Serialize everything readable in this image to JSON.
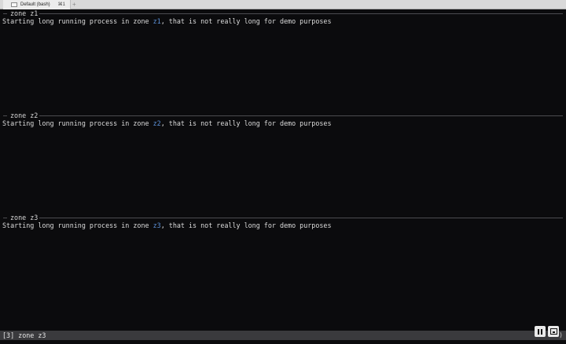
{
  "tabbar": {
    "tab_title": "Default (bash)",
    "tab_shortcut": "⌘1",
    "add_tab": "+"
  },
  "zones": [
    {
      "title": "zone z1",
      "output_prefix": "Starting long running process in zone ",
      "zone_id": "z1",
      "output_suffix": ", that is not really long for demo purposes"
    },
    {
      "title": "zone z2",
      "output_prefix": "Starting long running process in zone ",
      "zone_id": "z2",
      "output_suffix": ", that is not really long for demo purposes"
    },
    {
      "title": "zone z3",
      "output_prefix": "Starting long running process in zone ",
      "zone_id": "z3",
      "output_suffix": ", that is not really long for demo purposes"
    }
  ],
  "statusbar": {
    "text": "[3] zone z3",
    "right_glyph": ")"
  },
  "colors": {
    "terminal_bg": "#0b0b0d",
    "zone_id": "#5b8fd6",
    "statusbar_bg": "#3a3a3d"
  },
  "icons": [
    "terminal-icon",
    "pause-icon",
    "fullscreen-icon"
  ]
}
